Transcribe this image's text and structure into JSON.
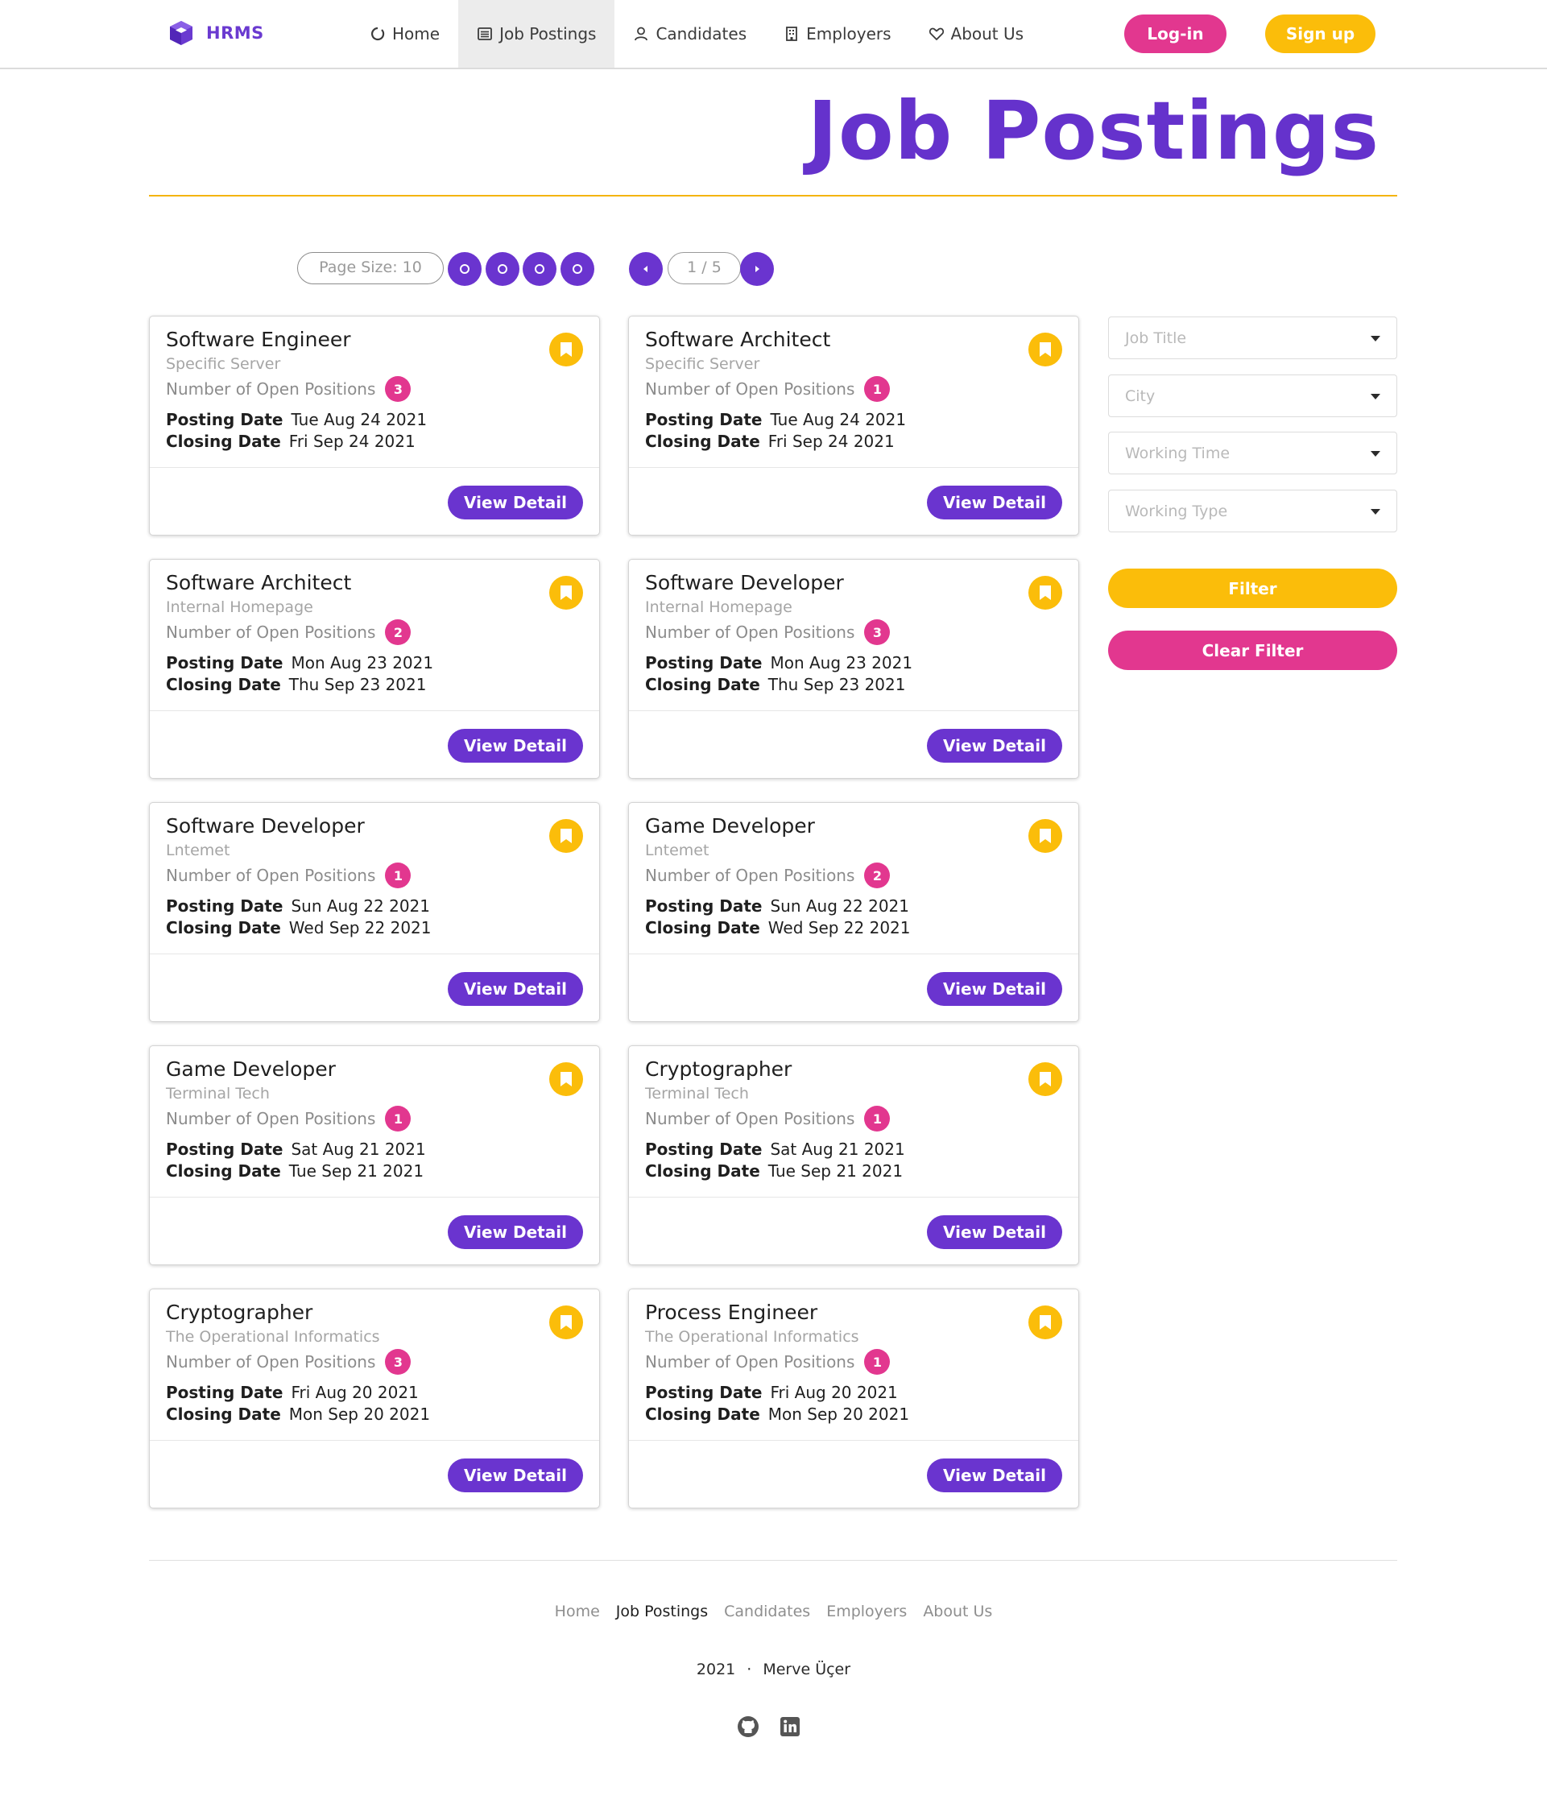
{
  "brand": {
    "name": "HRMS",
    "icon": "cube-icon",
    "color": "#6a3ad0"
  },
  "nav": {
    "items": [
      {
        "label": "Home",
        "icon": "circle-notch-icon",
        "active": false
      },
      {
        "label": "Job Postings",
        "icon": "list-icon",
        "active": true
      },
      {
        "label": "Candidates",
        "icon": "user-icon",
        "active": false
      },
      {
        "label": "Employers",
        "icon": "building-icon",
        "active": false
      },
      {
        "label": "About Us",
        "icon": "heart-icon",
        "active": false
      }
    ],
    "login_label": "Log-in",
    "signup_label": "Sign up"
  },
  "header": {
    "title": "Job Postings"
  },
  "pagination": {
    "page_size_label": "Page Size: 10",
    "page_indicator": "1 / 5"
  },
  "cards": [
    {
      "title": "Software Engineer",
      "employer": "Specific Server",
      "positions": "3",
      "posting_date": "Tue Aug 24 2021",
      "closing_date": "Fri Sep 24 2021"
    },
    {
      "title": "Software Architect",
      "employer": "Specific Server",
      "positions": "1",
      "posting_date": "Tue Aug 24 2021",
      "closing_date": "Fri Sep 24 2021"
    },
    {
      "title": "Software Architect",
      "employer": "Internal Homepage",
      "positions": "2",
      "posting_date": "Mon Aug 23 2021",
      "closing_date": "Thu Sep 23 2021"
    },
    {
      "title": "Software Developer",
      "employer": "Internal Homepage",
      "positions": "3",
      "posting_date": "Mon Aug 23 2021",
      "closing_date": "Thu Sep 23 2021"
    },
    {
      "title": "Software Developer",
      "employer": "Lntemet",
      "positions": "1",
      "posting_date": "Sun Aug 22 2021",
      "closing_date": "Wed Sep 22 2021"
    },
    {
      "title": "Game Developer",
      "employer": "Lntemet",
      "positions": "2",
      "posting_date": "Sun Aug 22 2021",
      "closing_date": "Wed Sep 22 2021"
    },
    {
      "title": "Game Developer",
      "employer": "Terminal Tech",
      "positions": "1",
      "posting_date": "Sat Aug 21 2021",
      "closing_date": "Tue Sep 21 2021"
    },
    {
      "title": "Cryptographer",
      "employer": "Terminal Tech",
      "positions": "1",
      "posting_date": "Sat Aug 21 2021",
      "closing_date": "Tue Sep 21 2021"
    },
    {
      "title": "Cryptographer",
      "employer": "The Operational Informatics",
      "positions": "3",
      "posting_date": "Fri Aug 20 2021",
      "closing_date": "Mon Sep 20 2021"
    },
    {
      "title": "Process Engineer",
      "employer": "The Operational Informatics",
      "positions": "1",
      "posting_date": "Fri Aug 20 2021",
      "closing_date": "Mon Sep 20 2021"
    }
  ],
  "card_labels": {
    "positions": "Number of Open Positions",
    "posting": "Posting Date",
    "closing": "Closing Date",
    "view_detail": "View Detail"
  },
  "filters": {
    "job_title_placeholder": "Job Title",
    "city_placeholder": "City",
    "working_time_placeholder": "Working Time",
    "working_type_placeholder": "Working Type",
    "filter_label": "Filter",
    "clear_label": "Clear Filter"
  },
  "footer": {
    "links": [
      "Home",
      "Job Postings",
      "Candidates",
      "Employers",
      "About Us"
    ],
    "year": "2021",
    "separator": "·",
    "author": "Merve Üçer",
    "icons": [
      "github-icon",
      "linkedin-icon"
    ]
  },
  "colors": {
    "purple": "#6a34cf",
    "pink": "#e2378f",
    "yellow": "#fbbd0a"
  }
}
